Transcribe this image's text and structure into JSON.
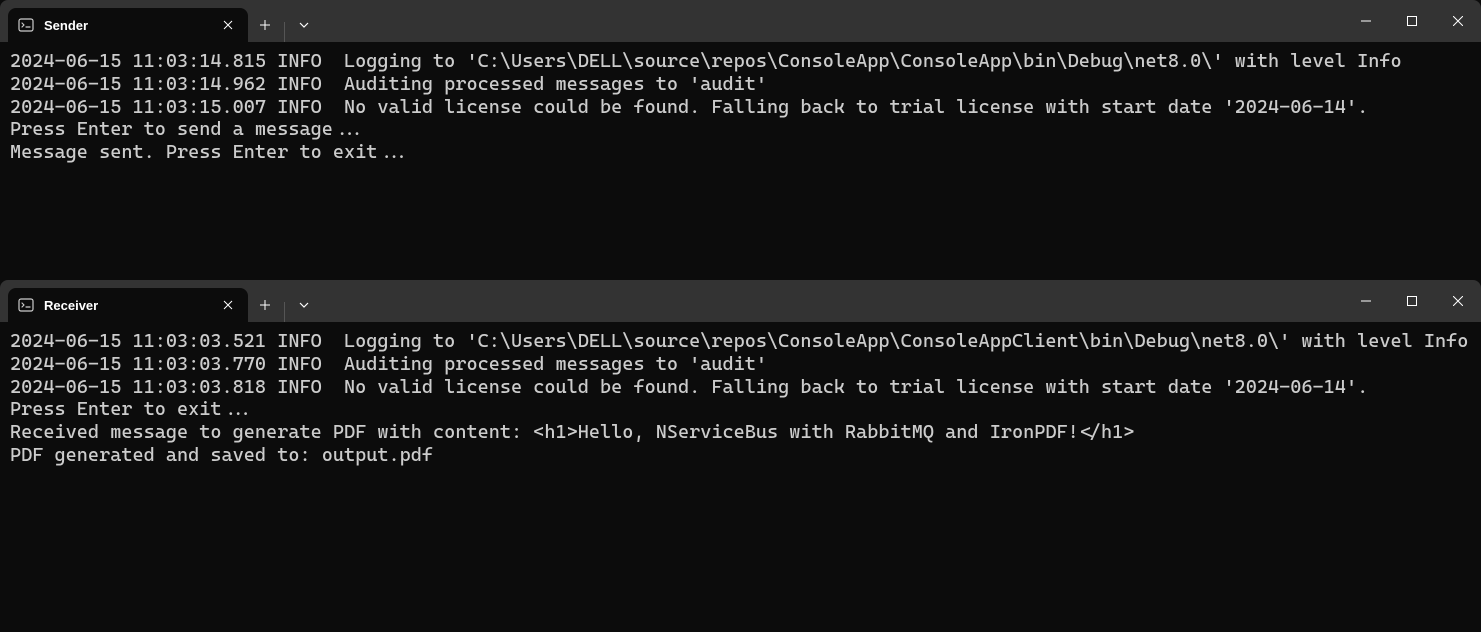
{
  "windows": [
    {
      "id": "sender",
      "tab_title": "Sender",
      "lines": [
        "2024-06-15 11:03:14.815 INFO  Logging to 'C:\\Users\\DELL\\source\\repos\\ConsoleApp\\ConsoleApp\\bin\\Debug\\net8.0\\' with level Info",
        "2024-06-15 11:03:14.962 INFO  Auditing processed messages to 'audit'",
        "2024-06-15 11:03:15.007 INFO  No valid license could be found. Falling back to trial license with start date '2024-06-14'.",
        "Press Enter to send a message...",
        "",
        "Message sent. Press Enter to exit..."
      ]
    },
    {
      "id": "receiver",
      "tab_title": "Receiver",
      "lines": [
        "2024-06-15 11:03:03.521 INFO  Logging to 'C:\\Users\\DELL\\source\\repos\\ConsoleApp\\ConsoleAppClient\\bin\\Debug\\net8.0\\' with level Info",
        "2024-06-15 11:03:03.770 INFO  Auditing processed messages to 'audit'",
        "2024-06-15 11:03:03.818 INFO  No valid license could be found. Falling back to trial license with start date '2024-06-14'.",
        "Press Enter to exit...",
        "Received message to generate PDF with content: <h1>Hello, NServiceBus with RabbitMQ and IronPDF!</h1>",
        "PDF generated and saved to: output.pdf"
      ]
    }
  ]
}
